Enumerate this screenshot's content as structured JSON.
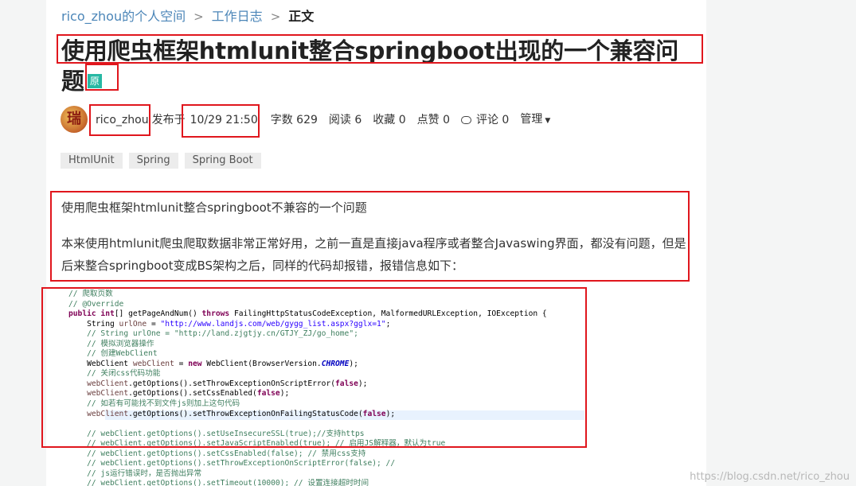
{
  "breadcrumb": {
    "space": "rico_zhou的个人空间",
    "section": "工作日志",
    "current": "正文"
  },
  "article": {
    "title": "使用爬虫框架htmlunit整合springboot出现的一个兼容问题",
    "badge": "原",
    "author": "rico_zhou",
    "avatar_char": "瑞",
    "published_label": "发布于",
    "published": "10/29 21:50",
    "wordcount": "字数 629",
    "reads": "阅读 6",
    "favs": "收藏 0",
    "likes": "点赞 0",
    "comments": "评论 0",
    "manage": "管理",
    "tags": [
      "HtmlUnit",
      "Spring",
      "Spring Boot"
    ],
    "para1": "使用爬虫框架htmlunit整合springboot不兼容的一个问题",
    "para2": "本来使用htmlunit爬虫爬取数据非常正常好用，之前一直是直接java程序或者整合Javaswing界面，都没有问题，但是后来整合springboot变成BS架构之后，同样的代码却报错，报错信息如下："
  },
  "watermark": "https://blog.csdn.net/rico_zhou"
}
